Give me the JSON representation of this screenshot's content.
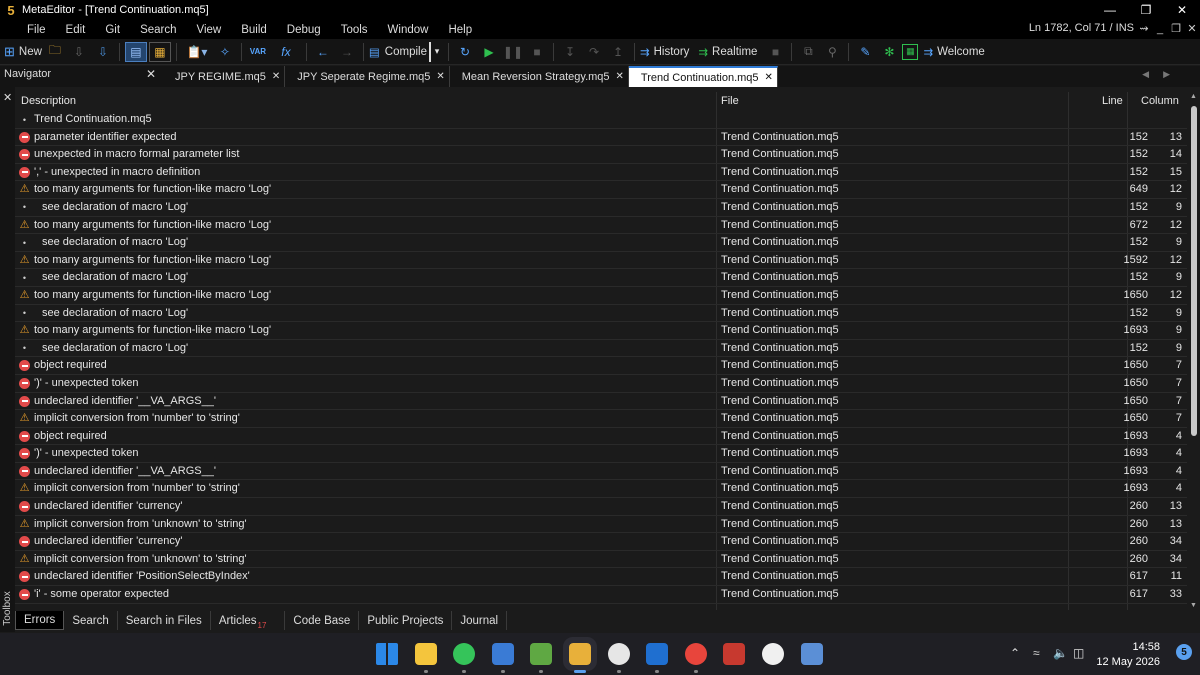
{
  "app": {
    "icon_label": "5",
    "title": "MetaEditor - [Trend Continuation.mq5]"
  },
  "menu": [
    "File",
    "Edit",
    "Git",
    "Search",
    "View",
    "Build",
    "Debug",
    "Tools",
    "Window",
    "Help"
  ],
  "status": {
    "cursor": "Ln 1782, Col 71  /  INS"
  },
  "toolbar": {
    "new_label": "New",
    "compile_label": "Compile",
    "history_label": "History",
    "realtime_label": "Realtime",
    "welcome_label": "Welcome",
    "var_label": "VAR",
    "fx_label": "fx"
  },
  "navigator": {
    "label": "Navigator"
  },
  "tabs": [
    {
      "label": "JPY REGIME.mq5",
      "active": false
    },
    {
      "label": "JPY Seperate Regime.mq5",
      "active": false
    },
    {
      "label": "Mean Reversion Strategy.mq5",
      "active": false
    },
    {
      "label": "Trend Continuation.mq5",
      "active": true
    }
  ],
  "errors_table": {
    "headers": {
      "description": "Description",
      "file": "File",
      "line": "Line",
      "column": "Column"
    },
    "rows": [
      {
        "type": "info",
        "desc": "Trend Continuation.mq5",
        "file": "",
        "line": "",
        "col": "",
        "indent": false
      },
      {
        "type": "error",
        "desc": "parameter identifier expected",
        "file": "Trend Continuation.mq5",
        "line": "152",
        "col": "13",
        "indent": false
      },
      {
        "type": "error",
        "desc": "unexpected in macro formal parameter list",
        "file": "Trend Continuation.mq5",
        "line": "152",
        "col": "14",
        "indent": false
      },
      {
        "type": "error",
        "desc": "',' - unexpected in macro definition",
        "file": "Trend Continuation.mq5",
        "line": "152",
        "col": "15",
        "indent": false
      },
      {
        "type": "warning",
        "desc": "too many arguments for function-like macro 'Log'",
        "file": "Trend Continuation.mq5",
        "line": "649",
        "col": "12",
        "indent": false
      },
      {
        "type": "info",
        "desc": "see declaration of macro 'Log'",
        "file": "Trend Continuation.mq5",
        "line": "152",
        "col": "9",
        "indent": true
      },
      {
        "type": "warning",
        "desc": "too many arguments for function-like macro 'Log'",
        "file": "Trend Continuation.mq5",
        "line": "672",
        "col": "12",
        "indent": false
      },
      {
        "type": "info",
        "desc": "see declaration of macro 'Log'",
        "file": "Trend Continuation.mq5",
        "line": "152",
        "col": "9",
        "indent": true
      },
      {
        "type": "warning",
        "desc": "too many arguments for function-like macro 'Log'",
        "file": "Trend Continuation.mq5",
        "line": "1592",
        "col": "12",
        "indent": false
      },
      {
        "type": "info",
        "desc": "see declaration of macro 'Log'",
        "file": "Trend Continuation.mq5",
        "line": "152",
        "col": "9",
        "indent": true
      },
      {
        "type": "warning",
        "desc": "too many arguments for function-like macro 'Log'",
        "file": "Trend Continuation.mq5",
        "line": "1650",
        "col": "12",
        "indent": false
      },
      {
        "type": "info",
        "desc": "see declaration of macro 'Log'",
        "file": "Trend Continuation.mq5",
        "line": "152",
        "col": "9",
        "indent": true
      },
      {
        "type": "warning",
        "desc": "too many arguments for function-like macro 'Log'",
        "file": "Trend Continuation.mq5",
        "line": "1693",
        "col": "9",
        "indent": false
      },
      {
        "type": "info",
        "desc": "see declaration of macro 'Log'",
        "file": "Trend Continuation.mq5",
        "line": "152",
        "col": "9",
        "indent": true
      },
      {
        "type": "error",
        "desc": "object required",
        "file": "Trend Continuation.mq5",
        "line": "1650",
        "col": "7",
        "indent": false
      },
      {
        "type": "error",
        "desc": "')' - unexpected token",
        "file": "Trend Continuation.mq5",
        "line": "1650",
        "col": "7",
        "indent": false
      },
      {
        "type": "error",
        "desc": "undeclared identifier '__VA_ARGS__'",
        "file": "Trend Continuation.mq5",
        "line": "1650",
        "col": "7",
        "indent": false
      },
      {
        "type": "warning",
        "desc": "implicit conversion from 'number' to 'string'",
        "file": "Trend Continuation.mq5",
        "line": "1650",
        "col": "7",
        "indent": false
      },
      {
        "type": "error",
        "desc": "object required",
        "file": "Trend Continuation.mq5",
        "line": "1693",
        "col": "4",
        "indent": false
      },
      {
        "type": "error",
        "desc": "')' - unexpected token",
        "file": "Trend Continuation.mq5",
        "line": "1693",
        "col": "4",
        "indent": false
      },
      {
        "type": "error",
        "desc": "undeclared identifier '__VA_ARGS__'",
        "file": "Trend Continuation.mq5",
        "line": "1693",
        "col": "4",
        "indent": false
      },
      {
        "type": "warning",
        "desc": "implicit conversion from 'number' to 'string'",
        "file": "Trend Continuation.mq5",
        "line": "1693",
        "col": "4",
        "indent": false
      },
      {
        "type": "error",
        "desc": "undeclared identifier 'currency'",
        "file": "Trend Continuation.mq5",
        "line": "260",
        "col": "13",
        "indent": false
      },
      {
        "type": "warning",
        "desc": "implicit conversion from 'unknown' to 'string'",
        "file": "Trend Continuation.mq5",
        "line": "260",
        "col": "13",
        "indent": false
      },
      {
        "type": "error",
        "desc": "undeclared identifier 'currency'",
        "file": "Trend Continuation.mq5",
        "line": "260",
        "col": "34",
        "indent": false
      },
      {
        "type": "warning",
        "desc": "implicit conversion from 'unknown' to 'string'",
        "file": "Trend Continuation.mq5",
        "line": "260",
        "col": "34",
        "indent": false
      },
      {
        "type": "error",
        "desc": "undeclared identifier 'PositionSelectByIndex'",
        "file": "Trend Continuation.mq5",
        "line": "617",
        "col": "11",
        "indent": false
      },
      {
        "type": "error",
        "desc": "'i' - some operator expected",
        "file": "Trend Continuation.mq5",
        "line": "617",
        "col": "33",
        "indent": false
      }
    ]
  },
  "toolbox": {
    "label": "Toolbox",
    "tabs": [
      {
        "label": "Errors",
        "active": true,
        "badge": ""
      },
      {
        "label": "Search",
        "active": false,
        "badge": ""
      },
      {
        "label": "Search in Files",
        "active": false,
        "badge": ""
      },
      {
        "label": "Articles",
        "active": false,
        "badge": "17"
      },
      {
        "label": "Code Base",
        "active": false,
        "badge": ""
      },
      {
        "label": "Public Projects",
        "active": false,
        "badge": ""
      },
      {
        "label": "Journal",
        "active": false,
        "badge": ""
      }
    ]
  },
  "taskbar": {
    "apps": [
      {
        "name": "windows-start-icon",
        "color": "#2b88e8"
      },
      {
        "name": "file-explorer-icon",
        "color": "#f4c53d"
      },
      {
        "name": "whatsapp-icon",
        "color": "#35c45a"
      },
      {
        "name": "microsoft-store-icon",
        "color": "#3a7bd5"
      },
      {
        "name": "metatrader-icon",
        "color": "#5fa843"
      },
      {
        "name": "metaeditor-icon",
        "color": "#e8b03a"
      },
      {
        "name": "chatgpt-icon",
        "color": "#e6e6e6"
      },
      {
        "name": "outlook-icon",
        "color": "#1f6fd0"
      },
      {
        "name": "chrome-icon",
        "color": "#e8453c"
      },
      {
        "name": "app-icon",
        "color": "#c7392f"
      },
      {
        "name": "github-icon",
        "color": "#f0f0f0"
      },
      {
        "name": "remote-desktop-icon",
        "color": "#5b8fd6"
      }
    ],
    "time": "14:58",
    "date": "12 May 2026",
    "notification_count": "5"
  }
}
